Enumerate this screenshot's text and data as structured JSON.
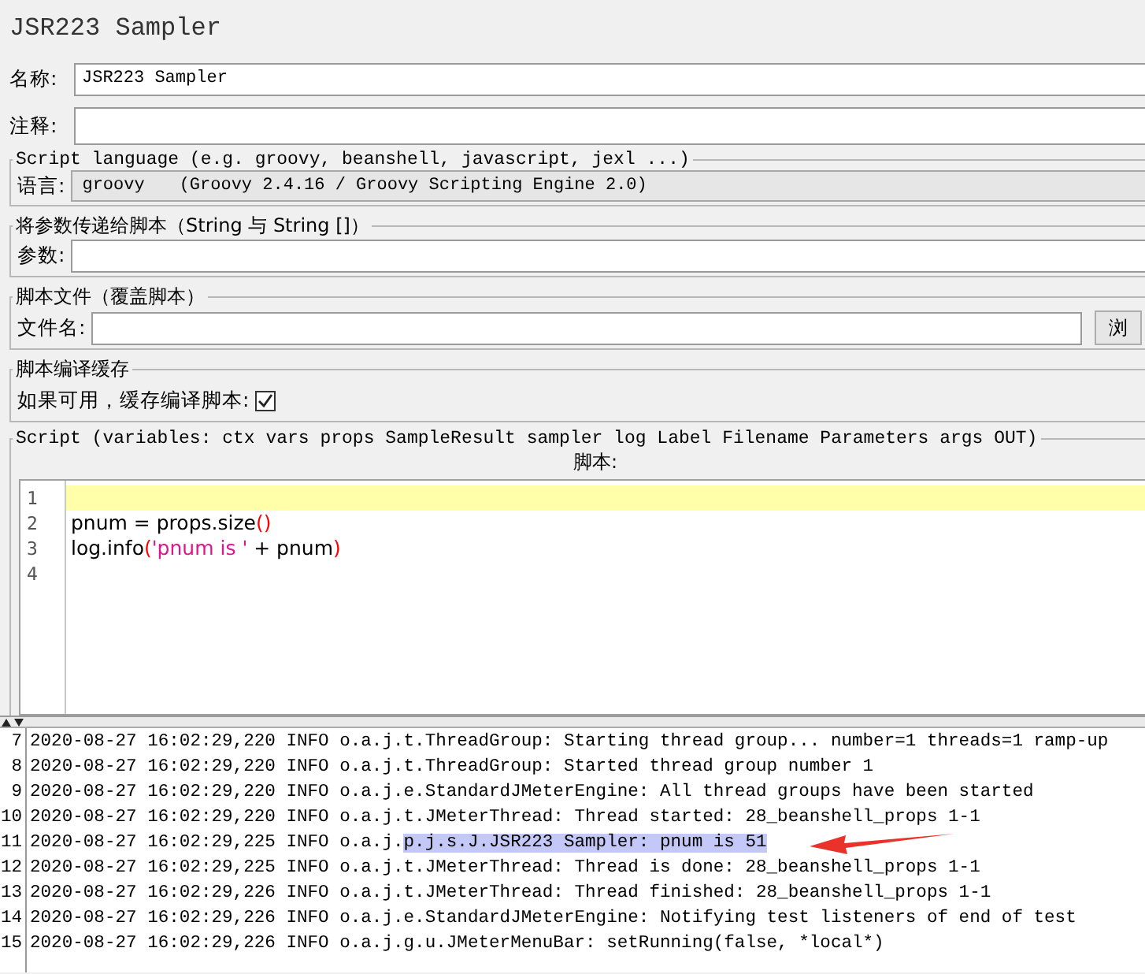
{
  "window": {
    "title": "JSR223 Sampler"
  },
  "fields": [
    {
      "label": "名称:",
      "value": "JSR223 Sampler"
    },
    {
      "label": "注释:"
    }
  ],
  "script_language": {
    "legend": "Script language (e.g. groovy, beanshell, javascript, jexl ...)",
    "label": "语言:",
    "value": "groovy",
    "description": "(Groovy 2.4.16 / Groovy Scripting Engine 2.0)"
  },
  "parameters": {
    "legend": "将参数传递给脚本（String 与 String []）",
    "label": "参数:"
  },
  "script_file": {
    "legend": "脚本文件（覆盖脚本）",
    "label": "文件名:",
    "button": "浏"
  },
  "cache": {
    "legend": "脚本编译缓存",
    "label": "如果可用，缓存编译脚本:",
    "checked": true
  },
  "script": {
    "legend": "Script (variables: ctx vars props SampleResult sampler log Label Filename Parameters args OUT)",
    "label": "脚本:",
    "lines": [
      {
        "number": "1",
        "current": true
      },
      {
        "number": "2",
        "current": false,
        "tokens": [
          {
            "kind": "plain",
            "text": "pnum = props.size"
          },
          {
            "kind": "bracket",
            "text": "()"
          }
        ]
      },
      {
        "number": "3",
        "current": false,
        "tokens": [
          {
            "kind": "plain",
            "text": "log.info"
          },
          {
            "kind": "bracket",
            "text": "("
          },
          {
            "kind": "string",
            "text": "'pnum is '"
          },
          {
            "kind": "plain",
            "text": " + pnum"
          },
          {
            "kind": "bracket",
            "text": ")"
          }
        ]
      },
      {
        "number": "4",
        "current": false
      }
    ]
  },
  "log": {
    "lines": [
      {
        "number": "7",
        "text": "2020-08-27 16:02:29,220 INFO o.a.j.t.ThreadGroup: Starting thread group... number=1 threads=1 ramp-up"
      },
      {
        "number": "8",
        "text": "2020-08-27 16:02:29,220 INFO o.a.j.t.ThreadGroup: Started thread group number 1"
      },
      {
        "number": "9",
        "text": "2020-08-27 16:02:29,220 INFO o.a.j.e.StandardJMeterEngine: All thread groups have been started"
      },
      {
        "number": "10",
        "text": "2020-08-27 16:02:29,220 INFO o.a.j.t.JMeterThread: Thread started: 28_beanshell_props 1-1"
      },
      {
        "number": "11",
        "text": "2020-08-27 16:02:29,225 INFO o.a.j.",
        "selected_text": "p.j.s.J.JSR223 Sampler: pnum is 51"
      },
      {
        "number": "12",
        "text": "2020-08-27 16:02:29,225 INFO o.a.j.t.JMeterThread: Thread is done: 28_beanshell_props 1-1"
      },
      {
        "number": "13",
        "text": "2020-08-27 16:02:29,226 INFO o.a.j.t.JMeterThread: Thread finished: 28_beanshell_props 1-1"
      },
      {
        "number": "14",
        "text": "2020-08-27 16:02:29,226 INFO o.a.j.e.StandardJMeterEngine: Notifying test listeners of end of test"
      },
      {
        "number": "15",
        "text": "2020-08-27 16:02:29,226 INFO o.a.j.g.u.JMeterMenuBar: setRunning(false, *local*)"
      }
    ]
  }
}
